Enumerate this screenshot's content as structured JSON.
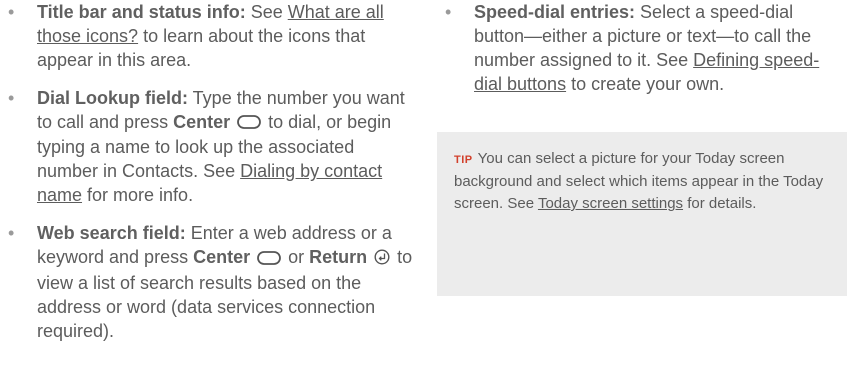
{
  "left_bullets": [
    {
      "term": "Title bar and status info:",
      "text_a": " See ",
      "link": "What are all those icons?",
      "text_b": " to learn about the icons that appear in this area."
    },
    {
      "term": "Dial Lookup field:",
      "text_a": " Type the number you want to call and press ",
      "key1": "Center",
      "text_b": " to dial, or begin typing a name to look up the associated number in Contacts. See ",
      "link": "Dialing by contact name",
      "text_c": " for more info."
    },
    {
      "term": "Web search field:",
      "text_a": " Enter a web address or a keyword and press ",
      "key1": "Center",
      "text_b": " or ",
      "key2": "Return",
      "text_c": " to view a list of search results based on the address or word (data services connection required)."
    }
  ],
  "right_bullets": [
    {
      "term": "Speed-dial entries:",
      "text_a": " Select a speed-dial button—either a picture or text—to call the number assigned to it. See ",
      "link": "Defining speed-dial buttons",
      "text_b": " to create your own."
    }
  ],
  "tip": {
    "label": "TIP",
    "text_a": "You can select a picture for your Today screen background and select which items appear in the Today screen. See ",
    "link": "Today screen settings",
    "text_b": " for details."
  },
  "bullet_glyph": "•",
  "icons": {
    "center_key": "center-key-icon",
    "return_key": "return-key-icon"
  },
  "colors": {
    "text": "#5c5c5c",
    "tip_label": "#d2402b",
    "tip_background": "#ececec"
  }
}
